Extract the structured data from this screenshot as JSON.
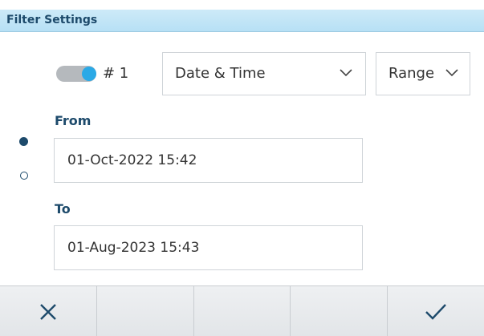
{
  "window": {
    "title": "Filter Settings"
  },
  "filter": {
    "enabled": true,
    "number_label": "# 1",
    "field_select": {
      "value": "Date & Time"
    },
    "mode_select": {
      "value": "Range"
    }
  },
  "pager": {
    "pages": 2,
    "current": 1
  },
  "from": {
    "label": "From",
    "value": "01-Oct-2022 15:42"
  },
  "to": {
    "label": "To",
    "value": "01-Aug-2023 15:43"
  },
  "softkeys": [
    {
      "icon": "close-icon"
    },
    {
      "icon": ""
    },
    {
      "icon": ""
    },
    {
      "icon": ""
    },
    {
      "icon": "checkmark-icon"
    }
  ],
  "colors": {
    "title_bar": "#b7e0f5",
    "accent": "#2ba9e6",
    "label": "#1d4a6b"
  }
}
